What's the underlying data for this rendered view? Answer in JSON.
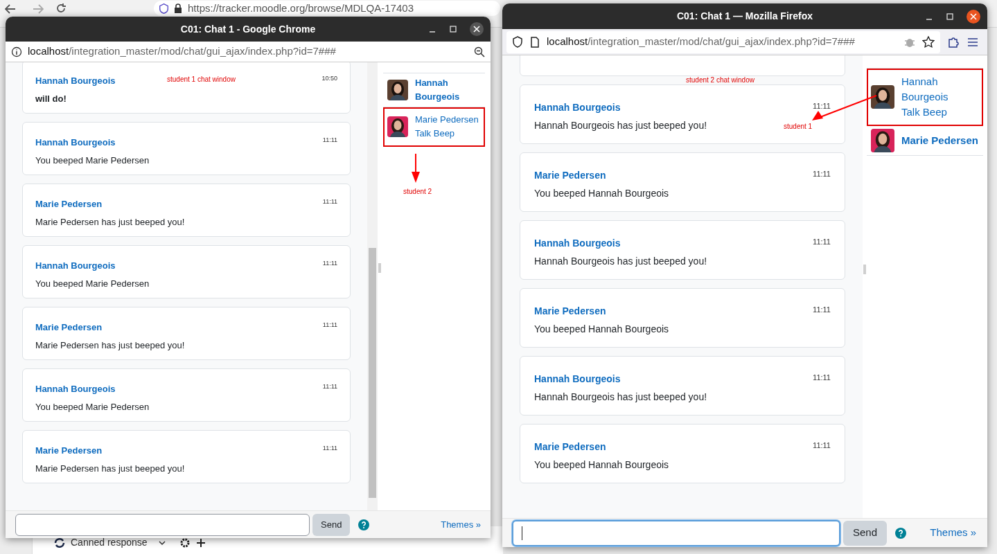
{
  "background_browser": {
    "url": "https://tracker.moodle.org/browse/MDLQA-17403",
    "toolbar_label": "Canned response"
  },
  "windows": [
    {
      "title": "C01: Chat 1 - Google Chrome",
      "kind": "chrome",
      "url": {
        "host": "localhost",
        "path": "/integration_master/mod/chat/gui_ajax/index.php?id=7###"
      },
      "messages": [
        {
          "sender": "Hannah Bourgeois",
          "time": "10:50",
          "text": "will do!",
          "bold": true
        },
        {
          "sender": "Hannah Bourgeois",
          "time": "11:11",
          "text": "You beeped Marie Pedersen",
          "bold": false
        },
        {
          "sender": "Marie Pedersen",
          "time": "11:11",
          "text": "Marie Pedersen has just beeped you!",
          "bold": false
        },
        {
          "sender": "Hannah Bourgeois",
          "time": "11:11",
          "text": "You beeped Marie Pedersen",
          "bold": false
        },
        {
          "sender": "Marie Pedersen",
          "time": "11:11",
          "text": "Marie Pedersen has just beeped you!",
          "bold": false
        },
        {
          "sender": "Hannah Bourgeois",
          "time": "11:11",
          "text": "You beeped Marie Pedersen",
          "bold": false
        },
        {
          "sender": "Marie Pedersen",
          "time": "11:11",
          "text": "Marie Pedersen has just beeped you!",
          "bold": false
        }
      ],
      "users": [
        {
          "name": "Hannah Bourgeois",
          "self": true,
          "highlighted": false
        },
        {
          "name": "Marie Pedersen",
          "self": false,
          "beep": "Talk Beep",
          "highlighted": true
        }
      ],
      "input": {
        "focused": false
      },
      "send": "Send",
      "themes": "Themes »"
    },
    {
      "title": "C01: Chat 1 — Mozilla Firefox",
      "kind": "firefox",
      "url": {
        "host": "localhost",
        "path": "/integration_master/mod/chat/gui_ajax/index.php?id=7###"
      },
      "partial_card_above": true,
      "messages": [
        {
          "sender": "Hannah Bourgeois",
          "time": "11:11",
          "text": "Hannah Bourgeois has just beeped you!",
          "bold": false
        },
        {
          "sender": "Marie Pedersen",
          "time": "11:11",
          "text": "You beeped Hannah Bourgeois",
          "bold": false
        },
        {
          "sender": "Hannah Bourgeois",
          "time": "11:11",
          "text": "Hannah Bourgeois has just beeped you!",
          "bold": false
        },
        {
          "sender": "Marie Pedersen",
          "time": "11:11",
          "text": "You beeped Hannah Bourgeois",
          "bold": false
        },
        {
          "sender": "Hannah Bourgeois",
          "time": "11:11",
          "text": "Hannah Bourgeois has just beeped you!",
          "bold": false
        },
        {
          "sender": "Marie Pedersen",
          "time": "11:11",
          "text": "You beeped Hannah Bourgeois",
          "bold": false
        }
      ],
      "users": [
        {
          "name": "Hannah Bourgeois",
          "self": false,
          "beep": "Talk Beep",
          "highlighted": true
        },
        {
          "name": "Marie Pedersen",
          "self": true,
          "highlighted": false
        }
      ],
      "input": {
        "focused": true
      },
      "send": "Send",
      "themes": "Themes »"
    }
  ],
  "annotations": [
    {
      "text": "student 1 chat window",
      "arrow": false
    },
    {
      "text": "student 2",
      "arrow": true
    },
    {
      "text": "student 2 chat window",
      "arrow": false
    },
    {
      "text": "student 1",
      "arrow": true
    }
  ]
}
